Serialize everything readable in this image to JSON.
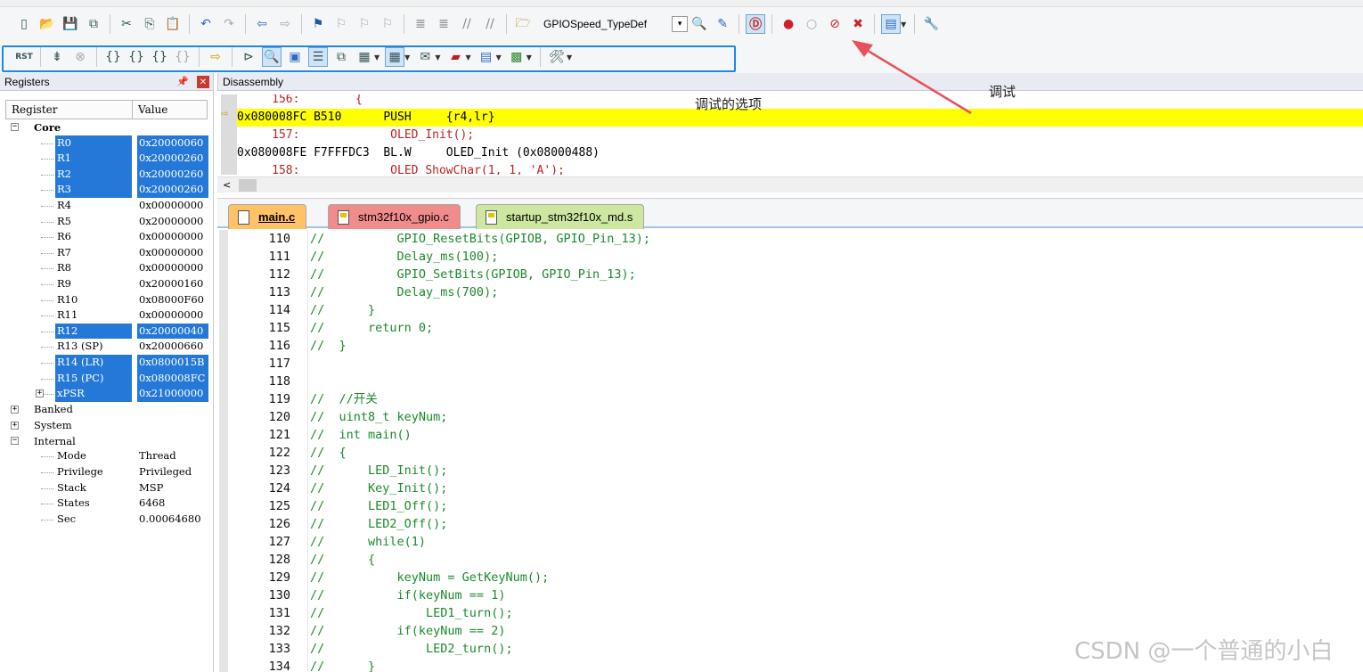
{
  "toolbar1": {
    "file_buttons": [
      "new-file-icon",
      "open-file-icon",
      "save-icon",
      "save-all-icon"
    ],
    "edit_buttons": [
      "cut-icon",
      "copy-icon",
      "paste-icon"
    ],
    "undo_buttons": [
      "undo-icon",
      "redo-icon"
    ],
    "nav_buttons": [
      "navigate-back-icon",
      "navigate-forward-icon"
    ],
    "bookmark_buttons": [
      "insert-bookmark-icon",
      "prev-bookmark-icon",
      "next-bookmark-icon",
      "clear-bookmarks-icon"
    ],
    "indent_buttons": [
      "indent-icon",
      "unindent-icon",
      "comment-icon",
      "uncomment-icon"
    ],
    "find_combo_value": "GPIOSpeed_TypeDef",
    "debug_toggle_label": "调试"
  },
  "annotations": {
    "debug_label": "调试",
    "debug_options_label": "调试的选项"
  },
  "registers": {
    "title": "Registers",
    "col_register": "Register",
    "col_value": "Value",
    "core_label": "Core",
    "core": [
      {
        "name": "R0",
        "value": "0x20000060",
        "selected": true
      },
      {
        "name": "R1",
        "value": "0x20000260",
        "selected": true
      },
      {
        "name": "R2",
        "value": "0x20000260",
        "selected": true
      },
      {
        "name": "R3",
        "value": "0x20000260",
        "selected": true
      },
      {
        "name": "R4",
        "value": "0x00000000",
        "selected": false
      },
      {
        "name": "R5",
        "value": "0x20000000",
        "selected": false
      },
      {
        "name": "R6",
        "value": "0x00000000",
        "selected": false
      },
      {
        "name": "R7",
        "value": "0x00000000",
        "selected": false
      },
      {
        "name": "R8",
        "value": "0x00000000",
        "selected": false
      },
      {
        "name": "R9",
        "value": "0x20000160",
        "selected": false
      },
      {
        "name": "R10",
        "value": "0x08000F60",
        "selected": false
      },
      {
        "name": "R11",
        "value": "0x00000000",
        "selected": false
      },
      {
        "name": "R12",
        "value": "0x20000040",
        "selected": true
      },
      {
        "name": "R13 (SP)",
        "value": "0x20000660",
        "selected": false
      },
      {
        "name": "R14 (LR)",
        "value": "0x0800015B",
        "selected": true
      },
      {
        "name": "R15 (PC)",
        "value": "0x080008FC",
        "selected": true
      },
      {
        "name": "xPSR",
        "value": "0x21000000",
        "selected": true
      }
    ],
    "banked_label": "Banked",
    "system_label": "System",
    "internal_label": "Internal",
    "internal": [
      {
        "name": "Mode",
        "value": "Thread"
      },
      {
        "name": "Privilege",
        "value": "Privileged"
      },
      {
        "name": "Stack",
        "value": "MSP"
      },
      {
        "name": "States",
        "value": "6468"
      },
      {
        "name": "Sec",
        "value": "0.00064680"
      }
    ]
  },
  "disassembly": {
    "title": "Disassembly",
    "lines": [
      {
        "text": "     156:        {",
        "kind": "src"
      },
      {
        "text": "0x080008FC B510      PUSH     {r4,lr}",
        "kind": "cur"
      },
      {
        "text": "     157:             OLED_Init();",
        "kind": "src"
      },
      {
        "text": "0x080008FE F7FFFDC3  BL.W     OLED_Init (0x08000488)",
        "kind": "asm"
      },
      {
        "text": "     158:             OLED_ShowChar(1, 1, 'A');",
        "kind": "src"
      }
    ]
  },
  "tabs": [
    {
      "label": "main.c"
    },
    {
      "label": "stm32f10x_gpio.c"
    },
    {
      "label": "startup_stm32f10x_md.s"
    }
  ],
  "code": [
    {
      "ln": "110",
      "text": "//          GPIO_ResetBits(GPIOB, GPIO_Pin_13);"
    },
    {
      "ln": "111",
      "text": "//          Delay_ms(100);"
    },
    {
      "ln": "112",
      "text": "//          GPIO_SetBits(GPIOB, GPIO_Pin_13);"
    },
    {
      "ln": "113",
      "text": "//          Delay_ms(700);"
    },
    {
      "ln": "114",
      "text": "//      }"
    },
    {
      "ln": "115",
      "text": "//      return 0;"
    },
    {
      "ln": "116",
      "text": "//  }"
    },
    {
      "ln": "117",
      "text": ""
    },
    {
      "ln": "118",
      "text": ""
    },
    {
      "ln": "119",
      "text": "//  //开关"
    },
    {
      "ln": "120",
      "text": "//  uint8_t keyNum;"
    },
    {
      "ln": "121",
      "text": "//  int main()"
    },
    {
      "ln": "122",
      "text": "//  {"
    },
    {
      "ln": "123",
      "text": "//      LED_Init();"
    },
    {
      "ln": "124",
      "text": "//      Key_Init();"
    },
    {
      "ln": "125",
      "text": "//      LED1_Off();"
    },
    {
      "ln": "126",
      "text": "//      LED2_Off();"
    },
    {
      "ln": "127",
      "text": "//      while(1)"
    },
    {
      "ln": "128",
      "text": "//      {"
    },
    {
      "ln": "129",
      "text": "//          keyNum = GetKeyNum();"
    },
    {
      "ln": "130",
      "text": "//          if(keyNum == 1)"
    },
    {
      "ln": "131",
      "text": "//              LED1_turn();"
    },
    {
      "ln": "132",
      "text": "//          if(keyNum == 2)"
    },
    {
      "ln": "133",
      "text": "//              LED2_turn();"
    },
    {
      "ln": "134",
      "text": "//      }"
    }
  ],
  "watermark": "CSDN @一个普通的小白",
  "colors": {
    "selection": "#2478d8",
    "current_line": "#ffff00",
    "comment": "#1a8a2a",
    "annotation_frame": "#1e88e5",
    "annotation_arrow": "#e8505b"
  }
}
